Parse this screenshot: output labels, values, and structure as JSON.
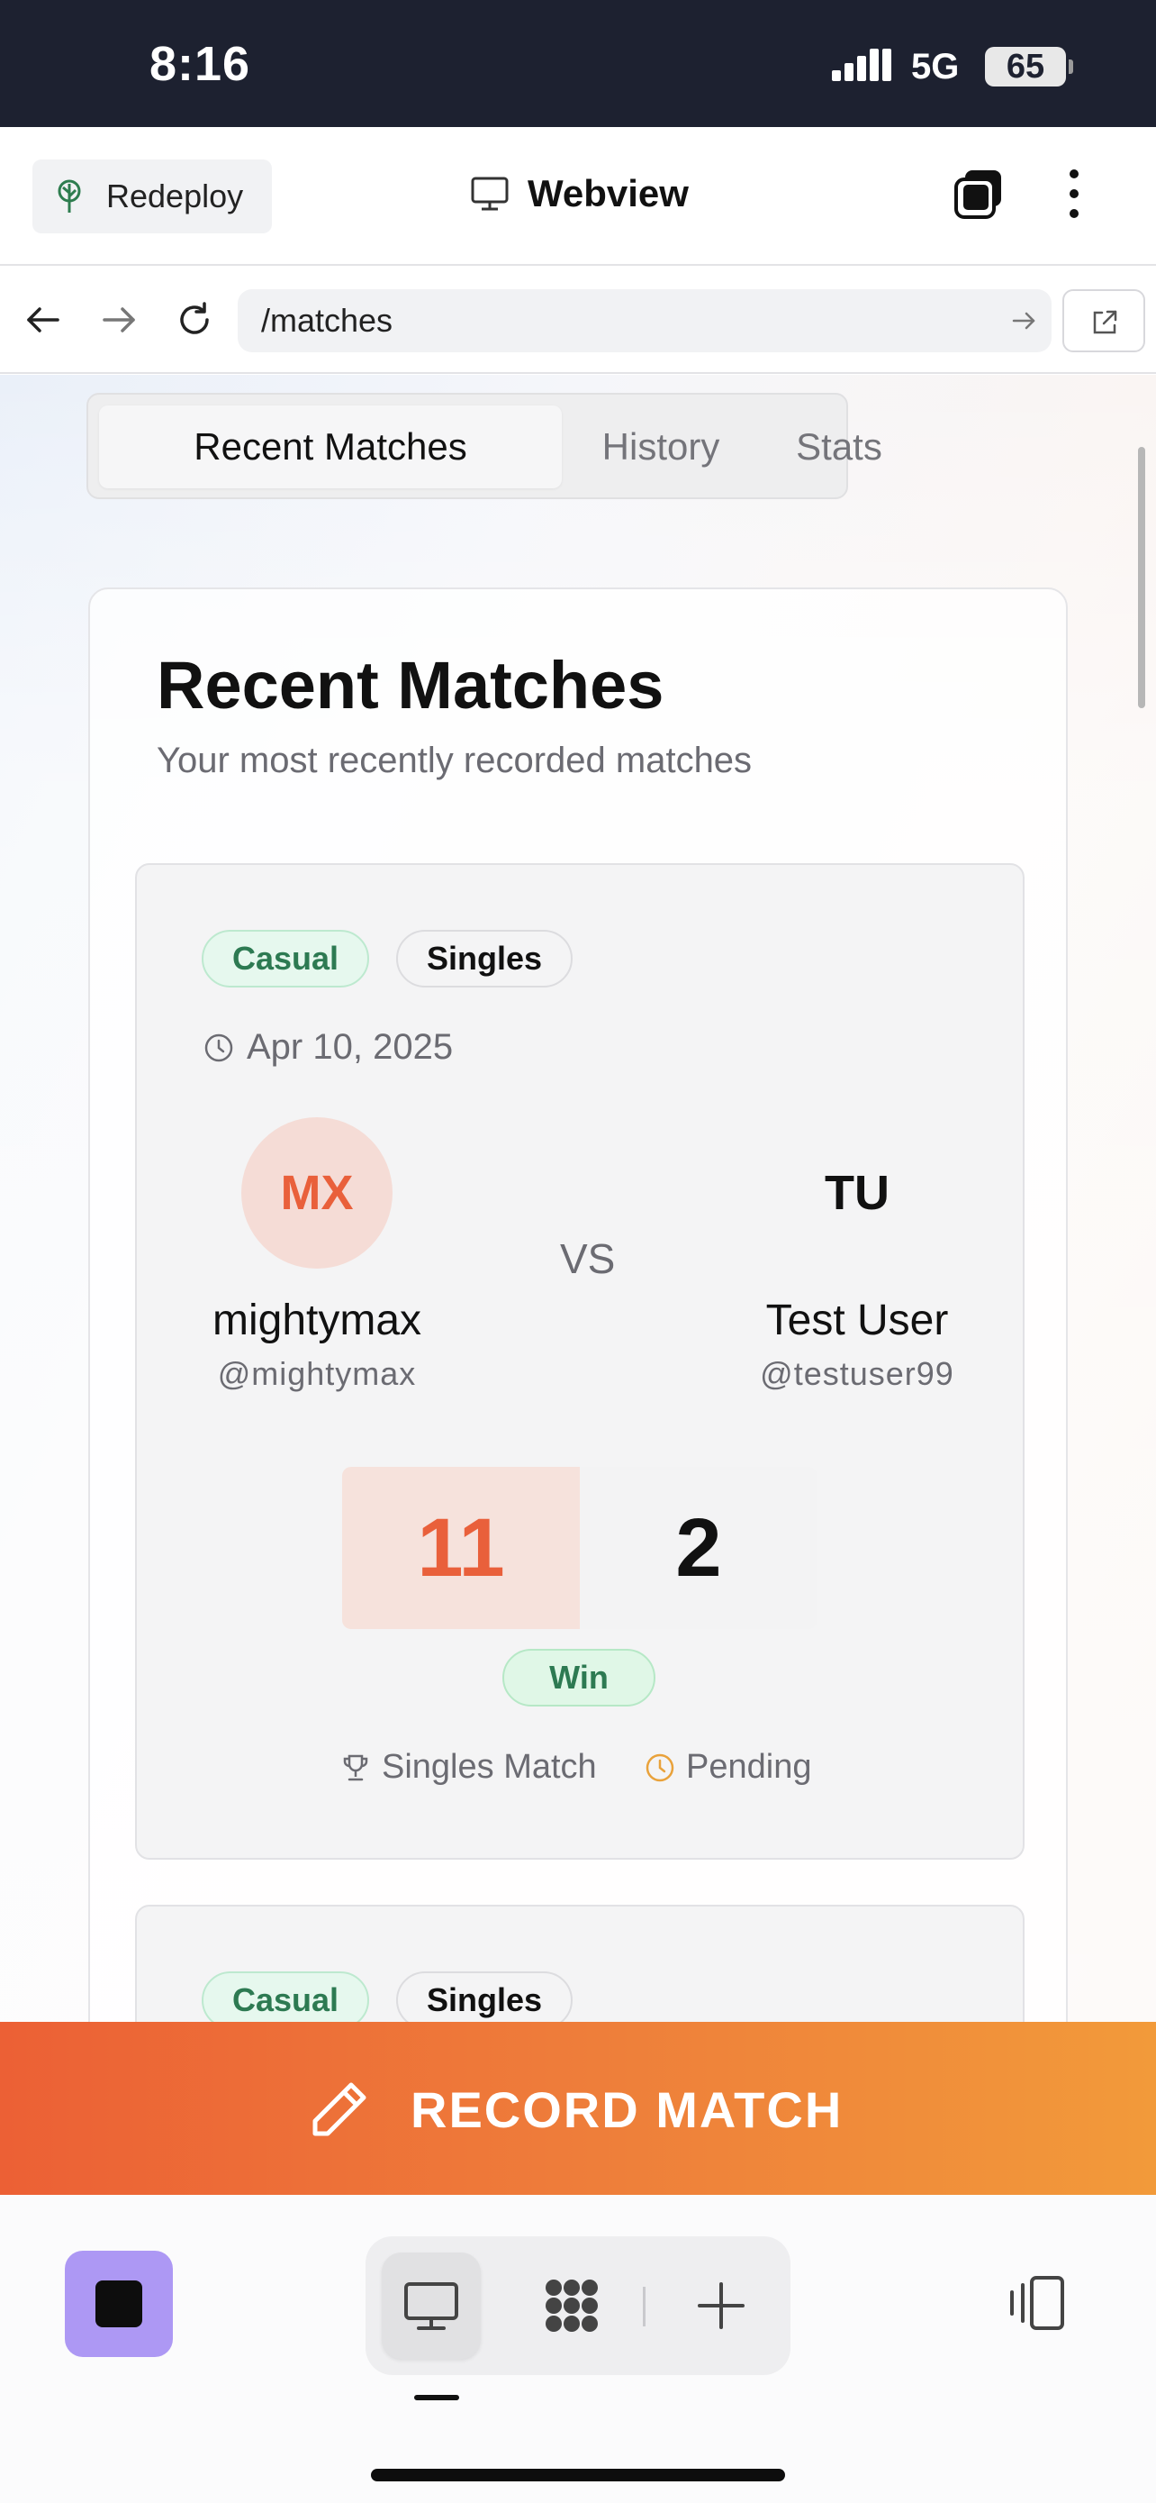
{
  "status_bar": {
    "time": "8:16",
    "network": "5G",
    "battery": "65"
  },
  "app_header": {
    "redeploy_label": "Redeploy",
    "title": "Webview"
  },
  "url_bar": {
    "url": "/matches"
  },
  "tabs": [
    {
      "label": "Recent Matches",
      "active": true
    },
    {
      "label": "History",
      "active": false
    },
    {
      "label": "Stats",
      "active": false
    }
  ],
  "panel": {
    "title": "Recent Matches",
    "subtitle": "Your most recently recorded matches"
  },
  "matches": [
    {
      "badges": [
        "Casual",
        "Singles"
      ],
      "date": "Apr 10, 2025",
      "vs": "VS",
      "player1": {
        "initials": "MX",
        "name": "mightymax",
        "handle": "@mightymax"
      },
      "player2": {
        "initials": "TU",
        "name": "Test User",
        "handle": "@testuser99"
      },
      "score1": "11",
      "score2": "2",
      "result": "Win",
      "match_type": "Singles Match",
      "status": "Pending"
    },
    {
      "badges": [
        "Casual",
        "Singles"
      ]
    }
  ],
  "record_button": {
    "label": "RECORD MATCH"
  },
  "colors": {
    "accent_orange": "#ec6035",
    "accent_orange_end": "#f29a3a",
    "win_green": "#2d7a52",
    "pending_amber": "#e9a23b",
    "stop_purple": "#ad98f4"
  },
  "icons": {
    "redeploy": "tree-icon",
    "webview": "monitor-icon",
    "tabs": "tabs-icon",
    "more": "more-vertical-icon",
    "back": "arrow-left-icon",
    "forward": "arrow-right-icon",
    "reload": "reload-icon",
    "go": "arrow-right-icon",
    "external": "external-link-icon",
    "date": "clock-icon",
    "match_type": "trophy-icon",
    "status": "clock-icon",
    "record": "pencil-icon",
    "stop": "stop-icon",
    "dock_desktop": "monitor-icon",
    "dock_grid": "grid-icon",
    "dock_add": "plus-icon",
    "devices": "devices-icon"
  }
}
